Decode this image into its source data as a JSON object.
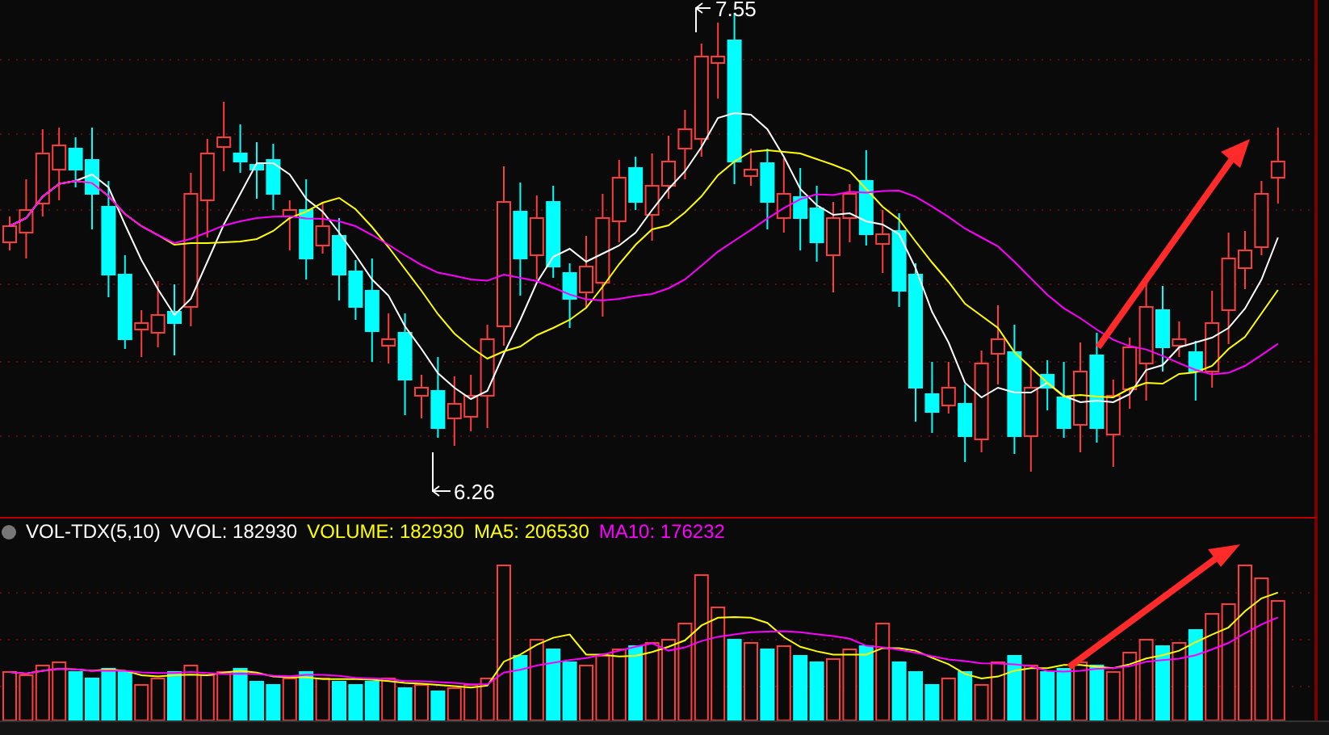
{
  "price_chart": {
    "high_marker": "7.55",
    "low_marker": "6.26"
  },
  "volume_panel": {
    "indicator": "VOL-TDX(5,10)",
    "readings": [
      {
        "label": "VVOL: 182930",
        "color": "#ffffff"
      },
      {
        "label": "VOLUME: 182930",
        "color": "#ffff00"
      },
      {
        "label": "MA5: 206530",
        "color": "#ffff00"
      },
      {
        "label": "MA10: 176232",
        "color": "#ff00ff"
      }
    ]
  }
}
